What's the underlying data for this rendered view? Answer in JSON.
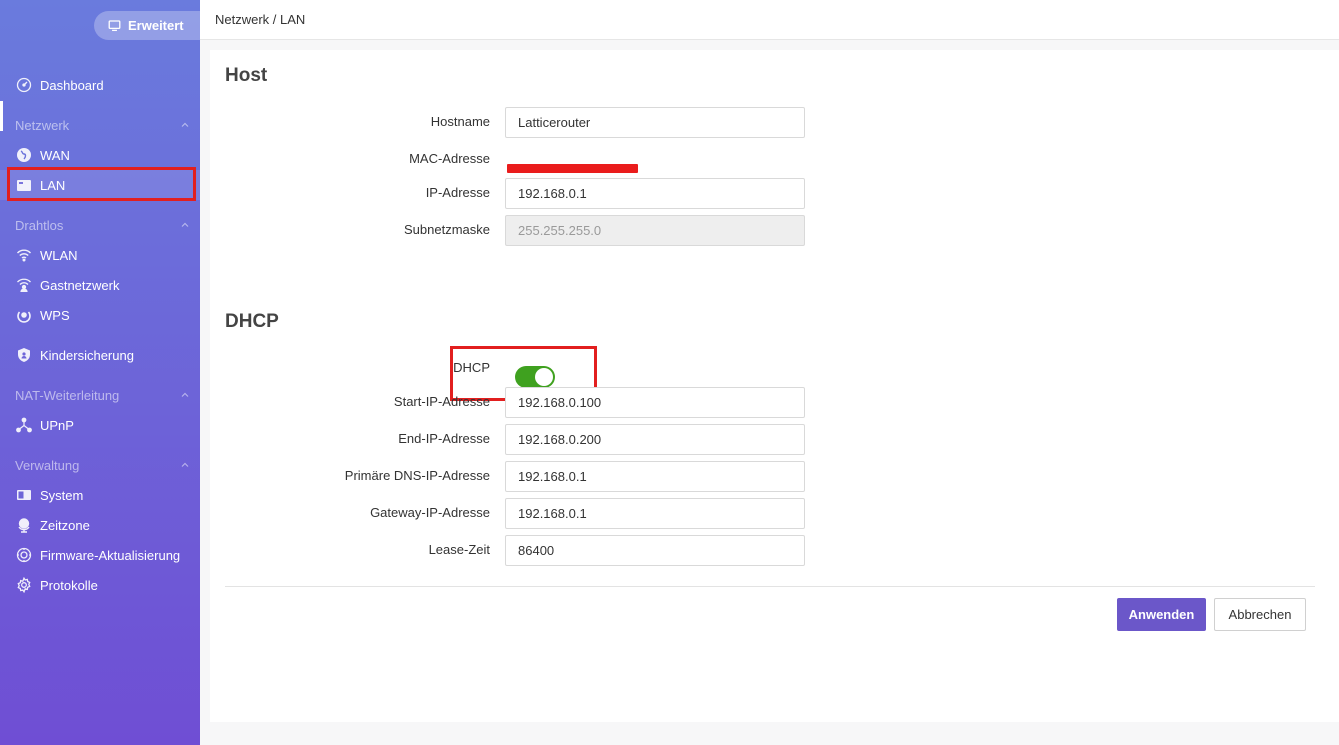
{
  "mode_button": {
    "label": "Erweitert",
    "icon": "monitor-icon"
  },
  "breadcrumb": "Netzwerk / LAN",
  "sidebar": {
    "items": [
      {
        "type": "item",
        "label": "Dashboard",
        "icon": "gauge-icon"
      },
      {
        "type": "section",
        "label": "Netzwerk"
      },
      {
        "type": "item",
        "label": "WAN",
        "icon": "globe-icon"
      },
      {
        "type": "item",
        "label": "LAN",
        "icon": "lan-icon",
        "active": true
      },
      {
        "type": "section",
        "label": "Drahtlos"
      },
      {
        "type": "item",
        "label": "WLAN",
        "icon": "wifi-icon"
      },
      {
        "type": "item",
        "label": "Gastnetzwerk",
        "icon": "guest-wifi-icon"
      },
      {
        "type": "item",
        "label": "WPS",
        "icon": "wps-icon"
      },
      {
        "type": "item",
        "label": "Kindersicherung",
        "icon": "parental-shield-icon"
      },
      {
        "type": "section",
        "label": "NAT-Weiterleitung"
      },
      {
        "type": "item",
        "label": "UPnP",
        "icon": "upnp-network-icon"
      },
      {
        "type": "section",
        "label": "Verwaltung"
      },
      {
        "type": "item",
        "label": "System",
        "icon": "system-icon"
      },
      {
        "type": "item",
        "label": "Zeitzone",
        "icon": "globe-stand-icon"
      },
      {
        "type": "item",
        "label": "Firmware-Aktualisierung",
        "icon": "firmware-update-icon"
      },
      {
        "type": "item",
        "label": "Protokolle",
        "icon": "gear-icon"
      }
    ]
  },
  "host": {
    "title": "Host",
    "hostname_label": "Hostname",
    "hostname_value": "Latticerouter",
    "mac_label": "MAC-Adresse",
    "ip_label": "IP-Adresse",
    "ip_value": "192.168.0.1",
    "subnet_label": "Subnetzmaske",
    "subnet_value": "255.255.255.0"
  },
  "dhcp": {
    "title": "DHCP",
    "toggle_label": "DHCP",
    "enabled": true,
    "start_label": "Start-IP-Adresse",
    "start_value": "192.168.0.100",
    "end_label": "End-IP-Adresse",
    "end_value": "192.168.0.200",
    "dns_label": "Primäre DNS-IP-Adresse",
    "dns_value": "192.168.0.1",
    "gateway_label": "Gateway-IP-Adresse",
    "gateway_value": "192.168.0.1",
    "lease_label": "Lease-Zeit",
    "lease_value": "86400"
  },
  "actions": {
    "apply": "Anwenden",
    "cancel": "Abbrechen"
  },
  "colors": {
    "accent": "#6b57c9",
    "toggle_on": "#3fa11f",
    "highlight": "#e21f1f"
  }
}
